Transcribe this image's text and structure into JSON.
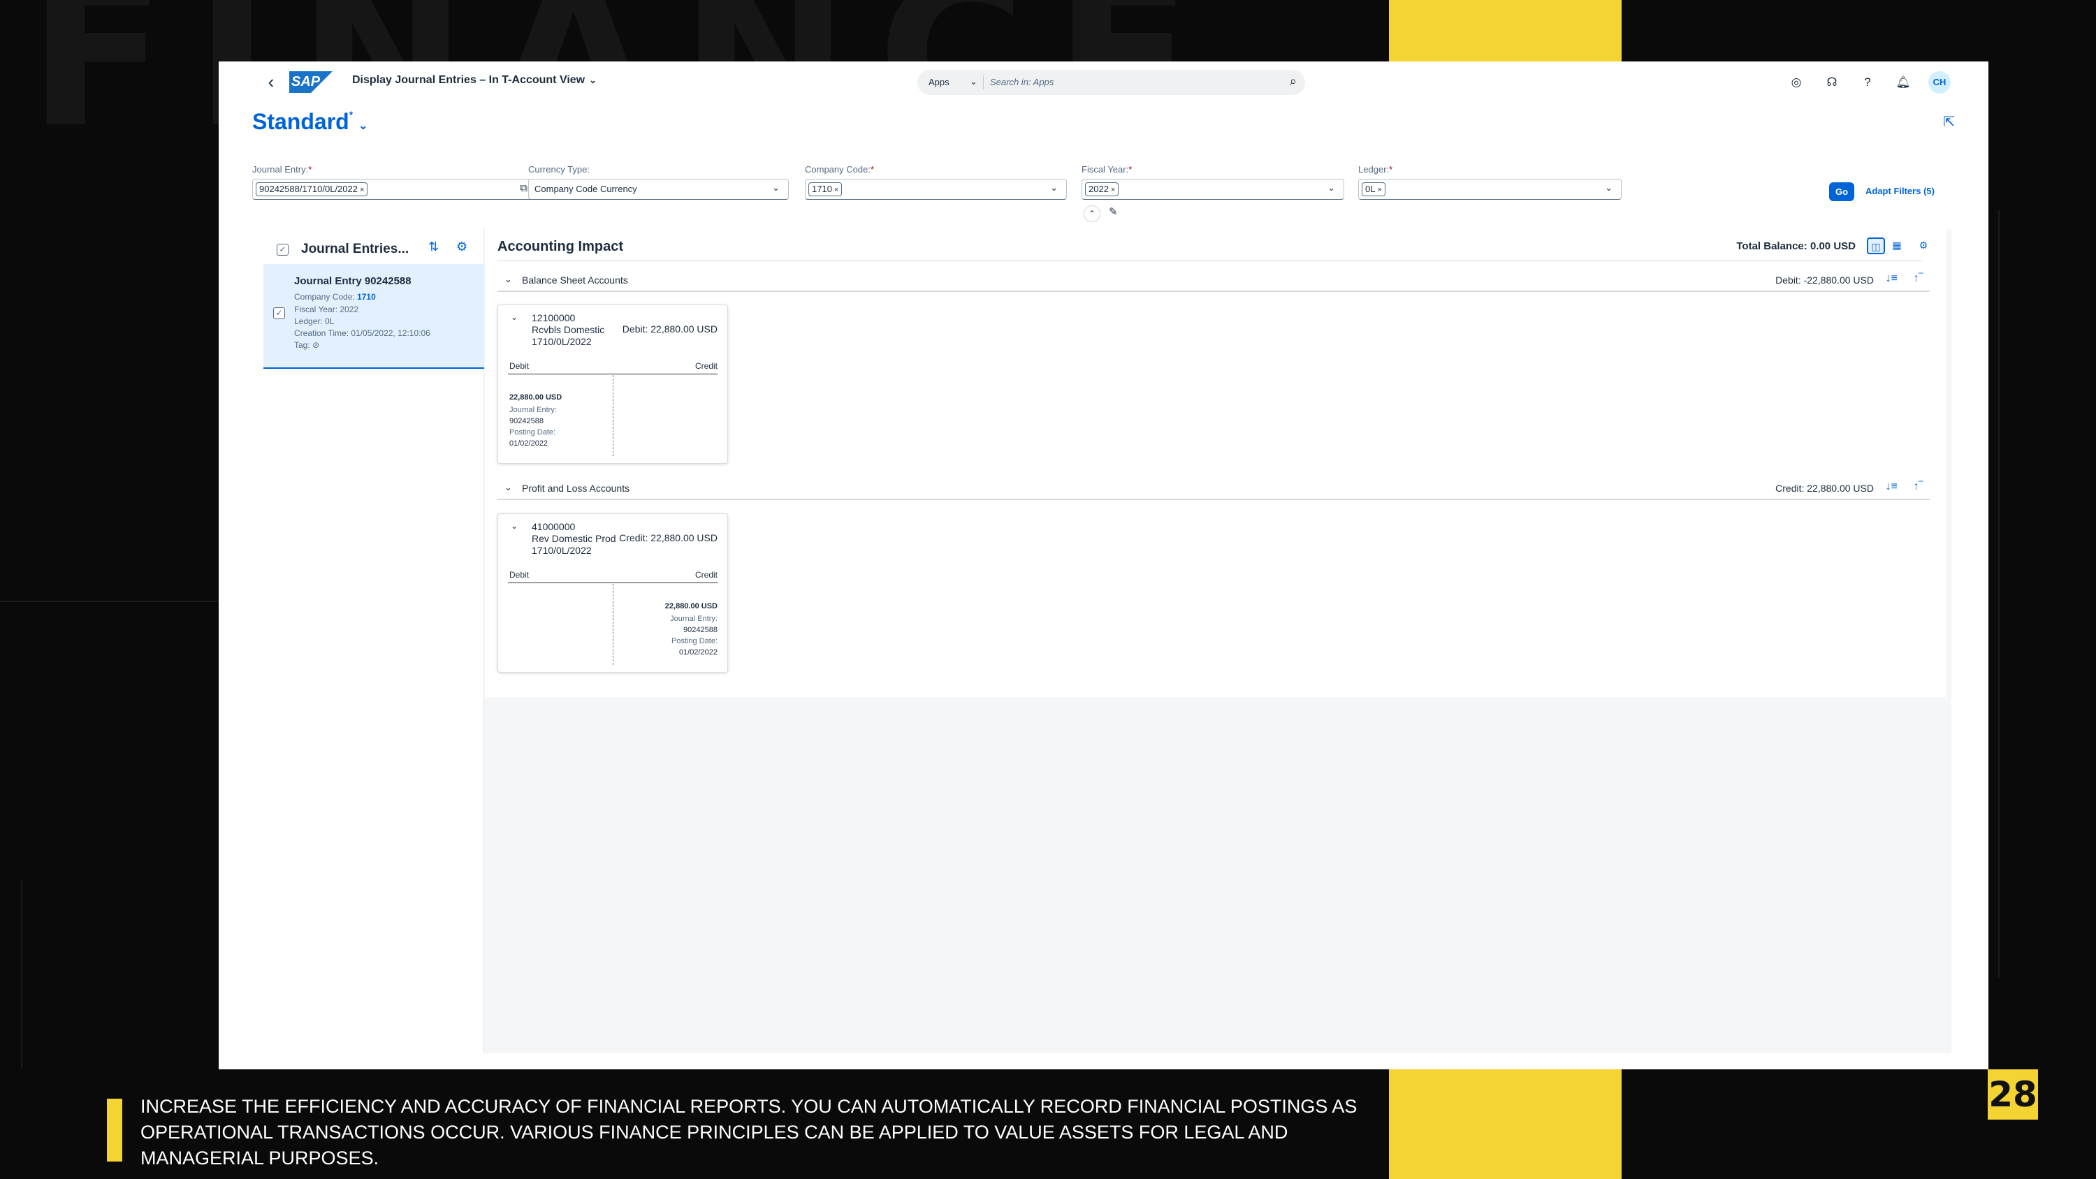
{
  "slide": {
    "background_word": "FINANCE",
    "caption": "INCREASE THE EFFICIENCY AND ACCURACY OF FINANCIAL REPORTS. YOU CAN AUTOMATICALLY RECORD FINANCIAL POSTINGS AS OPERATIONAL TRANSACTIONS OCCUR. VARIOUS FINANCE PRINCIPLES CAN BE APPLIED TO VALUE ASSETS FOR LEGAL AND MANAGERIAL PURPOSES.",
    "page_number": "28",
    "accent_color": "#f3d433"
  },
  "shell": {
    "logo": "SAP",
    "app_title": "Display Journal Entries – In T-Account View",
    "search_scope": "Apps",
    "search_placeholder": "Search in: Apps",
    "icons": [
      "copilot-icon",
      "headset-icon",
      "help-icon",
      "bell-icon"
    ],
    "avatar_initials": "CH"
  },
  "variant": {
    "name": "Standard",
    "modified_marker": "*"
  },
  "filters": {
    "journal_entry": {
      "label": "Journal Entry:",
      "token": "90242588/1710/0L/2022"
    },
    "currency_type": {
      "label": "Currency Type:",
      "value": "Company Code Currency"
    },
    "company_code": {
      "label": "Company Code:",
      "token": "1710"
    },
    "fiscal_year": {
      "label": "Fiscal Year:",
      "token": "2022"
    },
    "ledger": {
      "label": "Ledger:",
      "token": "0L"
    },
    "go_label": "Go",
    "adapt_label": "Adapt Filters (5)"
  },
  "left_panel": {
    "title": "Journal Entries...",
    "item": {
      "title": "Journal Entry 90242588",
      "company_code_label": "Company Code:",
      "company_code": "1710",
      "fiscal_year": "Fiscal Year: 2022",
      "ledger": "Ledger: 0L",
      "creation_time": "Creation Time: 01/05/2022, 12:10:06",
      "tag": "Tag:"
    }
  },
  "accounting_impact": {
    "title": "Accounting Impact",
    "total_balance_label": "Total Balance:",
    "total_balance": "0.00 USD",
    "sections": [
      {
        "label": "Balance Sheet Accounts",
        "balance": "Debit: -22,880.00 USD",
        "card": {
          "account": "12100000",
          "name": "Rcvbls Domestic",
          "key": "1710/0L/2022",
          "side_amount": "Debit: 22,880.00 USD",
          "debit_header": "Debit",
          "credit_header": "Credit",
          "entry_amount": "22,880.00 USD",
          "je_label": "Journal Entry:",
          "je_value": "90242588",
          "pd_label": "Posting Date:",
          "pd_value": "01/02/2022"
        }
      },
      {
        "label": "Profit and Loss Accounts",
        "balance": "Credit: 22,880.00 USD",
        "card": {
          "account": "41000000",
          "name": "Rev Domestic Prod",
          "key": "1710/0L/2022",
          "side_amount": "Credit: 22,880.00 USD",
          "debit_header": "Debit",
          "credit_header": "Credit",
          "entry_amount": "22,880.00 USD",
          "je_label": "Journal Entry:",
          "je_value": "90242588",
          "pd_label": "Posting Date:",
          "pd_value": "01/02/2022"
        }
      }
    ]
  }
}
